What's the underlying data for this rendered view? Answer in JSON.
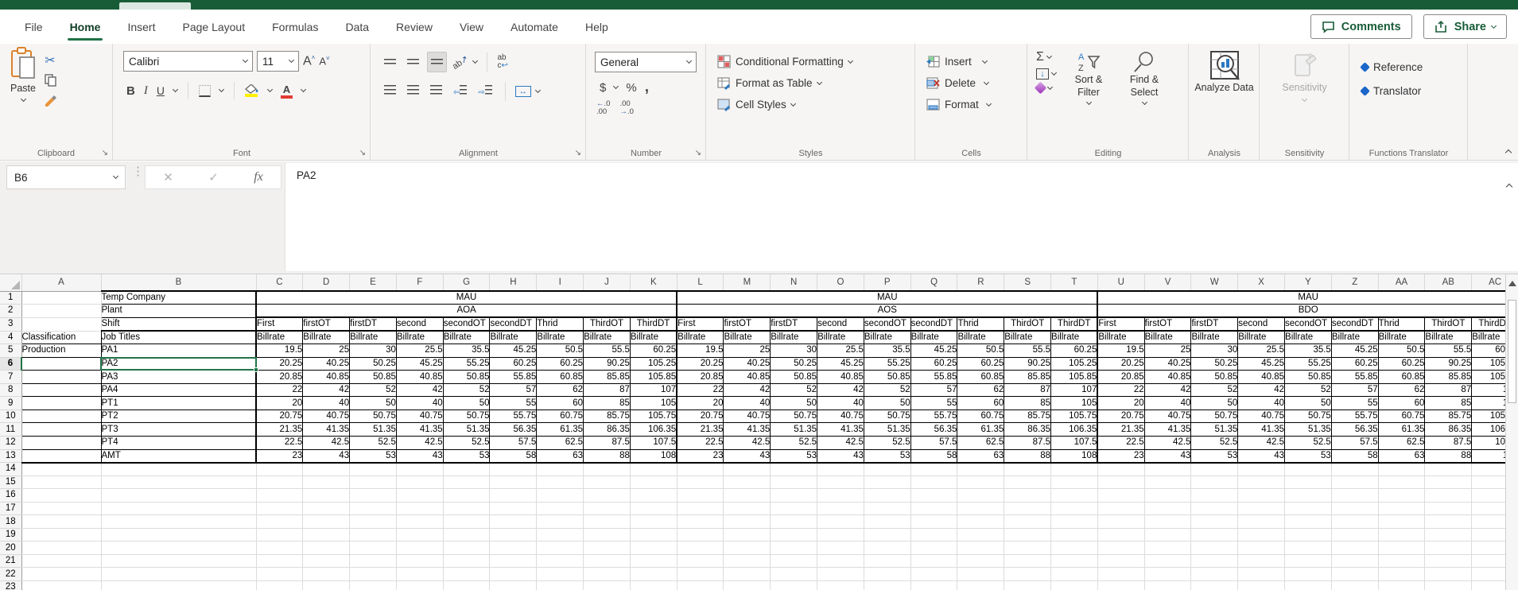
{
  "tabs": {
    "items": [
      "File",
      "Home",
      "Insert",
      "Page Layout",
      "Formulas",
      "Data",
      "Review",
      "View",
      "Automate",
      "Help"
    ],
    "active": "Home"
  },
  "actions": {
    "comments": "Comments",
    "share": "Share"
  },
  "ribbon": {
    "group_labels": [
      "Clipboard",
      "Font",
      "Alignment",
      "Number",
      "Styles",
      "Cells",
      "Editing",
      "Analysis",
      "Sensitivity",
      "Functions Translator"
    ],
    "paste": "Paste",
    "font_name": "Calibri",
    "font_size": "11",
    "number_format": "General",
    "styles": {
      "conditional": "Conditional Formatting",
      "format_table": "Format as Table",
      "cell_styles": "Cell Styles"
    },
    "cells": {
      "insert": "Insert",
      "delete": "Delete",
      "format": "Format"
    },
    "editing": {
      "sort": "Sort & Filter",
      "find": "Find & Select"
    },
    "analysis": {
      "analyze": "Analyze Data"
    },
    "sensitivity": "Sensitivity",
    "translator": {
      "reference": "Reference",
      "translator": "Translator"
    }
  },
  "formula_bar": {
    "name_box": "B6",
    "formula": "PA2"
  },
  "sheet": {
    "selected_cell": "B6",
    "selected_column": "B",
    "selected_row": 6,
    "last_visible_row": 23,
    "labels": {
      "b1": "Temp Company",
      "b2": "Plant",
      "b3": "Shift",
      "a4": "Classification",
      "b4": "Job Titles",
      "a5": "Production"
    },
    "groups": [
      {
        "company": "MAU",
        "plant": "AOA"
      },
      {
        "company": "MAU",
        "plant": "AOS"
      },
      {
        "company": "MAU",
        "plant": "BDO"
      }
    ],
    "shifts": [
      "First",
      "firstOT",
      "firstDT",
      "second",
      "secondOT",
      "secondDT",
      "Thrid",
      "ThirdOT",
      "ThirdDT"
    ],
    "rate_header": "Billrate",
    "jobs": [
      {
        "title": "PA1",
        "rates": [
          19.5,
          25,
          30,
          25.5,
          35.5,
          45.25,
          50.5,
          55.5,
          60.25
        ]
      },
      {
        "title": "PA2",
        "rates": [
          20.25,
          40.25,
          50.25,
          45.25,
          55.25,
          60.25,
          60.25,
          90.25,
          105.25
        ]
      },
      {
        "title": "PA3",
        "rates": [
          20.85,
          40.85,
          50.85,
          40.85,
          50.85,
          55.85,
          60.85,
          85.85,
          105.85
        ]
      },
      {
        "title": "PA4",
        "rates": [
          22,
          42,
          52,
          42,
          52,
          57,
          62,
          87,
          107
        ]
      },
      {
        "title": "PT1",
        "rates": [
          20,
          40,
          50,
          40,
          50,
          55,
          60,
          85,
          105
        ]
      },
      {
        "title": "PT2",
        "rates": [
          20.75,
          40.75,
          50.75,
          40.75,
          50.75,
          55.75,
          60.75,
          85.75,
          105.75
        ]
      },
      {
        "title": "PT3",
        "rates": [
          21.35,
          41.35,
          51.35,
          41.35,
          51.35,
          56.35,
          61.35,
          86.35,
          106.35
        ]
      },
      {
        "title": "PT4",
        "rates": [
          22.5,
          42.5,
          52.5,
          42.5,
          52.5,
          57.5,
          62.5,
          87.5,
          107.5
        ]
      },
      {
        "title": "AMT",
        "rates": [
          23,
          43,
          53,
          43,
          53,
          58,
          63,
          88,
          108
        ]
      }
    ]
  },
  "colors": {
    "accent": "#217346",
    "titlebar": "#185C37",
    "highlight_yellow": "#FFF000",
    "font_red": "#E03C31"
  }
}
